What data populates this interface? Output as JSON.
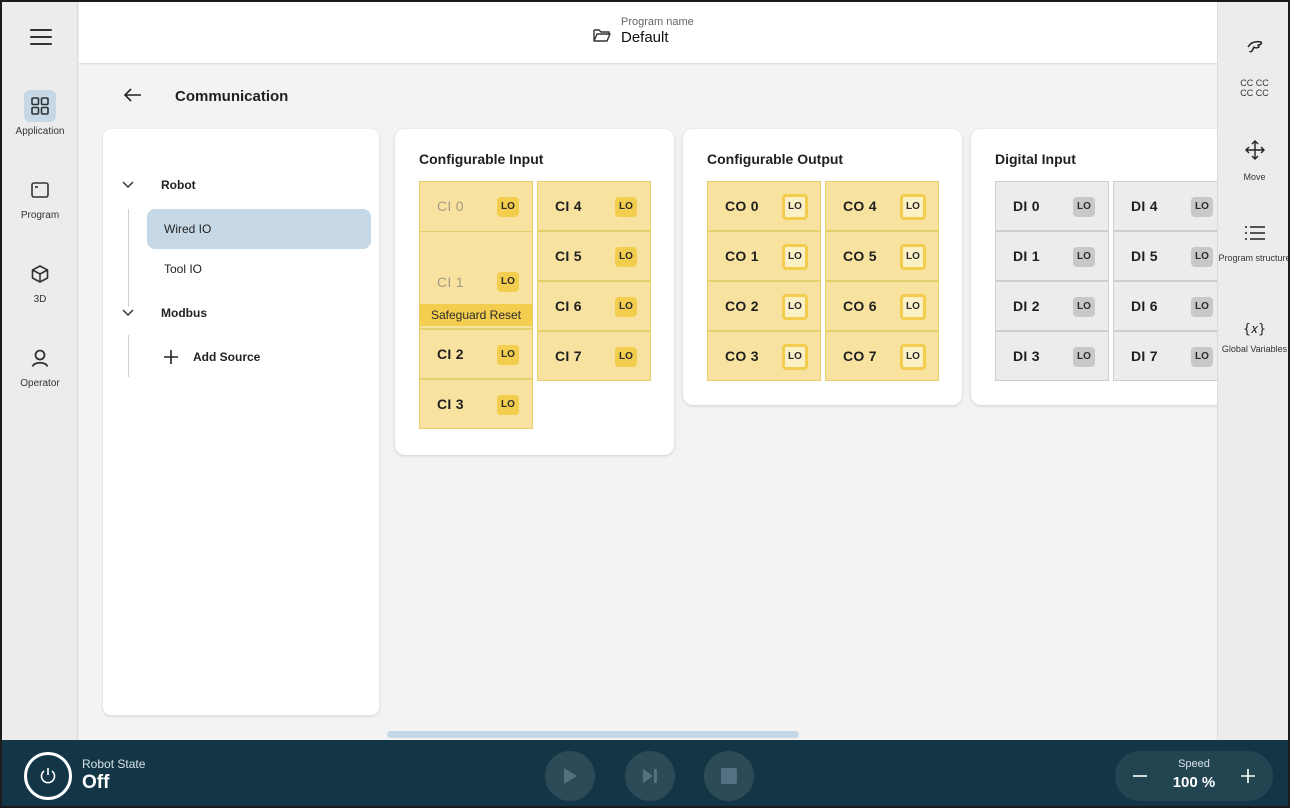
{
  "header": {
    "program_caption": "Program name",
    "program_value": "Default"
  },
  "left_nav": {
    "items": [
      {
        "label": "Application",
        "icon": "grid-icon"
      },
      {
        "label": "Program",
        "icon": "window-icon"
      },
      {
        "label": "3D",
        "icon": "cube-icon"
      },
      {
        "label": "Operator",
        "icon": "person-icon"
      }
    ],
    "active": "Application"
  },
  "page": {
    "title": "Communication"
  },
  "tree": {
    "groups": [
      {
        "label": "Robot",
        "items": [
          "Wired IO",
          "Tool IO"
        ]
      },
      {
        "label": "Modbus",
        "items": []
      }
    ],
    "selected": "Wired IO",
    "add_source_label": "Add Source"
  },
  "configurable_input": {
    "title": "Configurable Input",
    "ci0": "CI 0",
    "ci1": "CI 1",
    "ci2": "CI 2",
    "ci3": "CI 3",
    "ci4": "CI 4",
    "ci5": "CI 5",
    "ci6": "CI 6",
    "ci7": "CI 7",
    "safeguard_label": "Safeguard Reset",
    "level": "LO"
  },
  "configurable_output": {
    "title": "Configurable Output",
    "cells": [
      "CO 0",
      "CO 1",
      "CO 2",
      "CO 3",
      "CO 4",
      "CO 5",
      "CO 6",
      "CO 7"
    ],
    "level": "LO"
  },
  "digital_input": {
    "title": "Digital Input",
    "cells": [
      "DI 0",
      "DI 1",
      "DI 2",
      "DI 3",
      "DI 4",
      "DI 5",
      "DI 6",
      "DI 7"
    ],
    "level": "LO"
  },
  "right_bar": {
    "items": [
      {
        "label": "",
        "icon": "hand-icon"
      },
      {
        "label": "CC CC\nCC CC",
        "icon": ""
      },
      {
        "label": "Move",
        "icon": "move-arrows-icon"
      },
      {
        "label": "Program structure",
        "icon": "list-icon"
      },
      {
        "label": "Global Variables",
        "icon": "variable-icon"
      }
    ]
  },
  "bottom": {
    "robot_state_caption": "Robot State",
    "robot_state_value": "Off",
    "speed_caption": "Speed",
    "speed_value": "100 %"
  },
  "colors": {
    "accent_selected": "#c6d8e5",
    "io_yellow": "#f8e2a0",
    "io_yellow_tag": "#f3cd4d",
    "io_gray": "#ececec",
    "bottom_bar": "#133646"
  }
}
